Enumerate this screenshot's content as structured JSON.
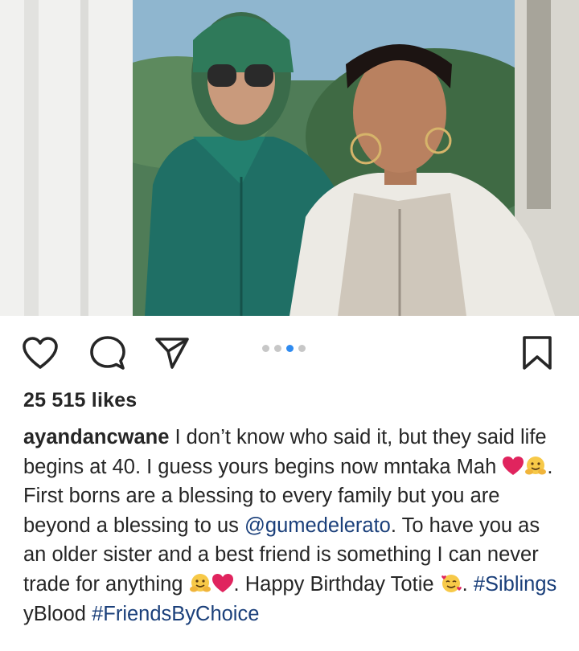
{
  "post": {
    "likes_text": "25 515 likes",
    "username": "ayandancwane",
    "caption": {
      "p1": " I don’t know who said it, but they said life begins at 40. I guess yours begins now mntaka Mah ",
      "p2": ". First borns are a blessing to every family but you are beyond a blessing to us ",
      "mention": "@gumedelerato",
      "p3": ". To have you as an older sister and a best friend is something I can never trade for anything ",
      "p4": ". Happy Birthday Totie ",
      "p5": ". ",
      "hashtag1": "#Siblings",
      "p6": " yBlood ",
      "hashtag2": "#FriendsByChoice"
    }
  },
  "carousel": {
    "count": 4,
    "active_index": 2
  },
  "icons": {
    "like": "heart-outline-icon",
    "comment": "comment-bubble-icon",
    "share": "paper-plane-icon",
    "save": "bookmark-outline-icon",
    "emoji_heart": "red-heart-emoji",
    "emoji_hug": "hugging-face-emoji",
    "emoji_love": "smiling-face-with-hearts-emoji"
  },
  "colors": {
    "active_dot": "#2f8bf0",
    "link": "#1a3f7a",
    "heart": "#e0245e"
  }
}
